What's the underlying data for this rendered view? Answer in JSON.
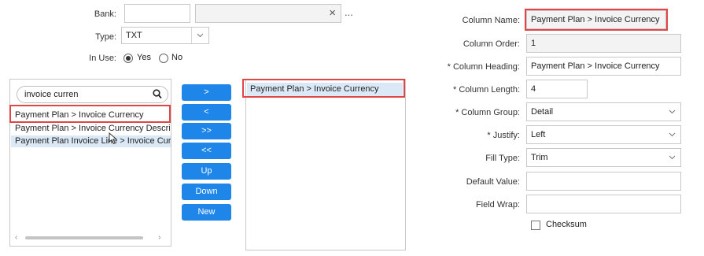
{
  "left_form": {
    "bank_label": "Bank:",
    "type_label": "Type:",
    "type_value": "TXT",
    "in_use_label": "In Use:",
    "yes_label": "Yes",
    "no_label": "No",
    "clear_symbol": "×",
    "more_symbol": "..."
  },
  "available_list": {
    "search_value": "invoice curren",
    "items": [
      "Payment Plan > Invoice Currency",
      "Payment Plan > Invoice Currency Descript",
      "Payment Plan Invoice Line > Invoice Curre"
    ]
  },
  "buttons": {
    "add": ">",
    "remove": "<",
    "add_all": ">>",
    "remove_all": "<<",
    "up": "Up",
    "down": "Down",
    "new": "New"
  },
  "selected_list": {
    "items": [
      "Payment Plan > Invoice Currency"
    ]
  },
  "details": {
    "column_name_label": "Column Name:",
    "column_name_value": "Payment Plan > Invoice Currency",
    "column_order_label": "Column Order:",
    "column_order_value": "1",
    "column_heading_label": "* Column Heading:",
    "column_heading_value": "Payment Plan > Invoice Currency",
    "column_length_label": "* Column Length:",
    "column_length_value": "4",
    "column_group_label": "* Column Group:",
    "column_group_value": "Detail",
    "justify_label": "* Justify:",
    "justify_value": "Left",
    "fill_type_label": "Fill Type:",
    "fill_type_value": "Trim",
    "default_value_label": "Default Value:",
    "default_value_value": "",
    "field_wrap_label": "Field Wrap:",
    "field_wrap_value": "",
    "checksum_label": "Checksum"
  },
  "colors": {
    "button_blue": "#1f86e9",
    "highlight_red": "#e04646",
    "selection_blue": "#dbe9f7"
  }
}
